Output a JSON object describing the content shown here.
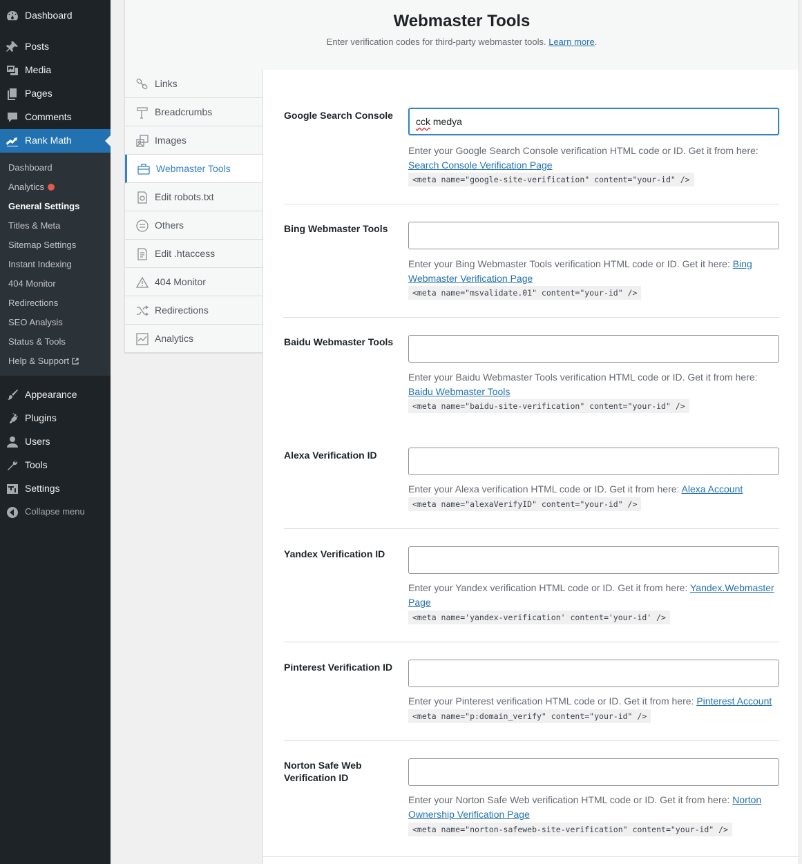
{
  "admin_menu": {
    "top_items": [
      {
        "label": "Dashboard",
        "icon": "dashboard-icon"
      },
      {
        "label": "Posts",
        "icon": "pin-icon"
      },
      {
        "label": "Media",
        "icon": "media-icon"
      },
      {
        "label": "Pages",
        "icon": "pages-icon"
      },
      {
        "label": "Comments",
        "icon": "comments-icon"
      },
      {
        "label": "Rank Math",
        "icon": "rank-math-icon"
      }
    ],
    "submenu": [
      {
        "label": "Dashboard"
      },
      {
        "label": "Analytics"
      },
      {
        "label": "General Settings"
      },
      {
        "label": "Titles & Meta"
      },
      {
        "label": "Sitemap Settings"
      },
      {
        "label": "Instant Indexing"
      },
      {
        "label": "404 Monitor"
      },
      {
        "label": "Redirections"
      },
      {
        "label": "SEO Analysis"
      },
      {
        "label": "Status & Tools"
      },
      {
        "label": "Help & Support"
      }
    ],
    "bottom_items": [
      {
        "label": "Appearance",
        "icon": "brush-icon"
      },
      {
        "label": "Plugins",
        "icon": "plugin-icon"
      },
      {
        "label": "Users",
        "icon": "user-icon"
      },
      {
        "label": "Tools",
        "icon": "wrench-icon"
      },
      {
        "label": "Settings",
        "icon": "settings-icon"
      }
    ],
    "collapse_label": "Collapse menu"
  },
  "header": {
    "title": "Webmaster Tools",
    "description": "Enter verification codes for third-party webmaster tools.",
    "learn_more": "Learn more"
  },
  "tabs": [
    {
      "label": "Links",
      "icon": "link-icon"
    },
    {
      "label": "Breadcrumbs",
      "icon": "signpost-icon"
    },
    {
      "label": "Images",
      "icon": "images-icon"
    },
    {
      "label": "Webmaster Tools",
      "icon": "briefcase-icon"
    },
    {
      "label": "Edit robots.txt",
      "icon": "robot-file-icon"
    },
    {
      "label": "Others",
      "icon": "circle-lines-icon"
    },
    {
      "label": "Edit .htaccess",
      "icon": "document-icon"
    },
    {
      "label": "404 Monitor",
      "icon": "warning-icon"
    },
    {
      "label": "Redirections",
      "icon": "shuffle-icon"
    },
    {
      "label": "Analytics",
      "icon": "chart-icon"
    }
  ],
  "fields": [
    {
      "label": "Google Search Console",
      "value": "cck medya",
      "desc": "Enter your Google Search Console verification HTML code or ID. Get it from here: ",
      "link": "Search Console Verification Page",
      "code": "<meta name=\"google-site-verification\" content=\"your-id\" />"
    },
    {
      "label": "Bing Webmaster Tools",
      "value": "",
      "desc": "Enter your Bing Webmaster Tools verification HTML code or ID. Get it here: ",
      "link": "Bing Webmaster Verification Page",
      "code": "<meta name=\"msvalidate.01\" content=\"your-id\" />"
    },
    {
      "label": "Baidu Webmaster Tools",
      "value": "",
      "desc": "Enter your Baidu Webmaster Tools verification HTML code or ID. Get it from here: ",
      "link": "Baidu Webmaster Tools",
      "code": "<meta name=\"baidu-site-verification\" content=\"your-id\" />"
    },
    {
      "label": "Alexa Verification ID",
      "value": "",
      "desc": "Enter your Alexa verification HTML code or ID. Get it from here: ",
      "link": "Alexa Account",
      "code": "<meta name=\"alexaVerifyID\" content=\"your-id\" />"
    },
    {
      "label": "Yandex Verification ID",
      "value": "",
      "desc": "Enter your Yandex verification HTML code or ID. Get it from here: ",
      "link": "Yandex.Webmaster Page",
      "code": "<meta name='yandex-verification' content='your-id' />"
    },
    {
      "label": "Pinterest Verification ID",
      "value": "",
      "desc": "Enter your Pinterest verification HTML code or ID. Get it from here: ",
      "link": "Pinterest Account",
      "code": "<meta name=\"p:domain_verify\" content=\"your-id\" />"
    },
    {
      "label": "Norton Safe Web Verification ID",
      "value": "",
      "desc": "Enter your Norton Safe Web verification HTML code or ID. Get it from here: ",
      "link": "Norton Ownership Verification Page",
      "code": "<meta name=\"norton-safeweb-site-verification\" content=\"your-id\" />"
    }
  ],
  "colors": {
    "sidebar_bg": "#1d2327",
    "submenu_bg": "#2c3338",
    "accent": "#2271b1",
    "active_tab": "#3582c4",
    "alert_dot": "#e35950"
  }
}
